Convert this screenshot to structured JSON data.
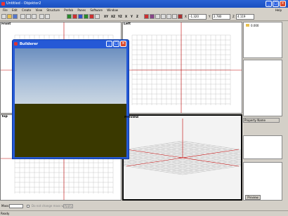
{
  "window": {
    "title": "Untitled - Objektor2"
  },
  "menu": {
    "items": [
      "File",
      "Edit",
      "Create",
      "View",
      "Structure",
      "Prefab",
      "Panes",
      "Software",
      "Window"
    ],
    "help": "Help"
  },
  "coords": {
    "x_label": "X",
    "x_value": "-1.320",
    "y_label": "Y",
    "y_value": "2.780",
    "z_label": "Z",
    "z_value": "4.119"
  },
  "toolbar_text": {
    "xy": "XY",
    "xz": "XZ",
    "yz": "YZ",
    "x": "X",
    "y": "Y",
    "z": "Z"
  },
  "viewports": {
    "front": "Front",
    "left": "Left",
    "top": "Top",
    "preview": "Preview"
  },
  "right_panel": {
    "item": "0.000",
    "property_header": "Property Name",
    "preview_button": "Preview"
  },
  "floating": {
    "title": "Builderer"
  },
  "bottom": {
    "mass_label": "Mass:",
    "checkbox_label": "Do not change mass w.",
    "apply_label": "Apply"
  },
  "status": {
    "text": "Ready"
  },
  "colors": {
    "accent": "#2559d6",
    "axis": "#c00000",
    "ground": "#3a3900"
  }
}
